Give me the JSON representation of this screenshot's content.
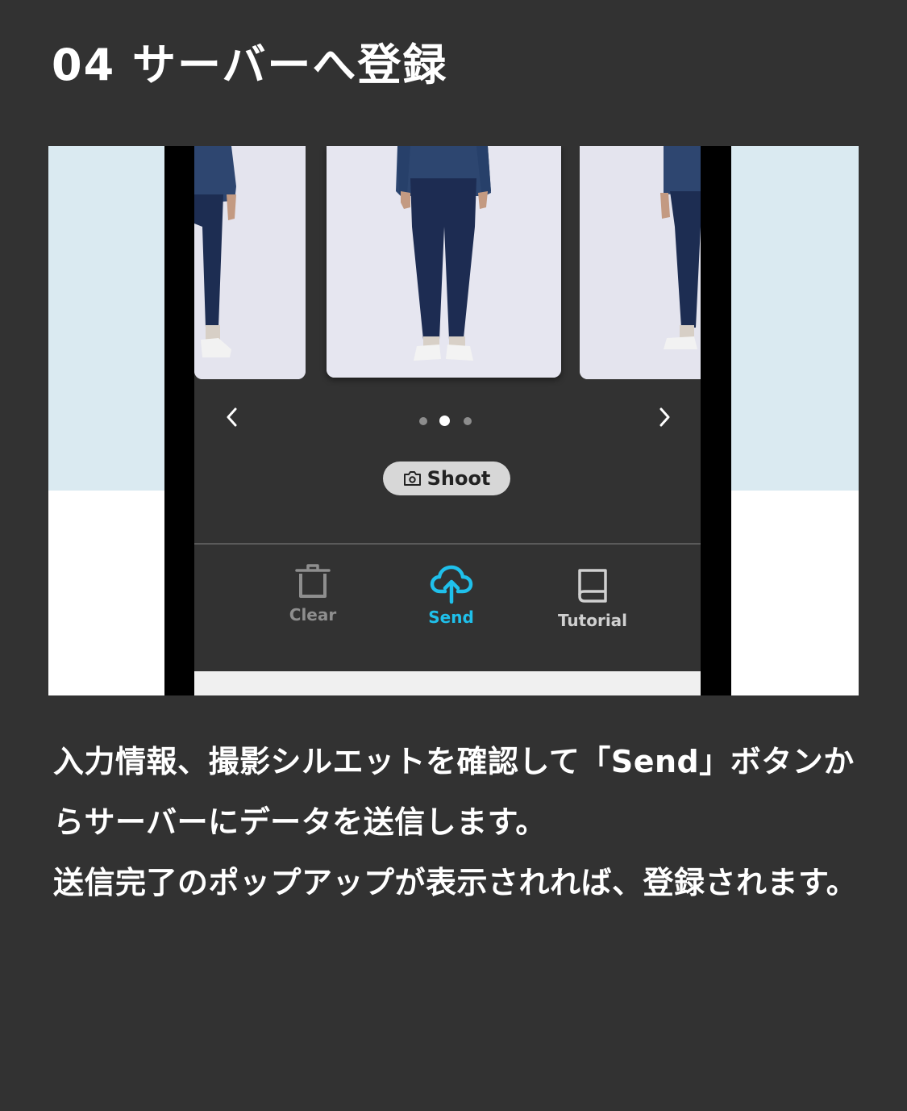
{
  "heading": "04 サーバーへ登録",
  "app": {
    "shoot_label": "Shoot",
    "tabs": {
      "clear": "Clear",
      "send": "Send",
      "tutorial": "Tutorial"
    },
    "pagination": {
      "pages": 3,
      "current": 2
    },
    "accent_color": "#1fc0eb"
  },
  "description": {
    "paragraph1": "入力情報、撮影シルエットを確認して「Send」ボタンからサーバーにデータを送信します。",
    "paragraph2": "送信完了のポップアップが表示されれば、登録されます。"
  }
}
